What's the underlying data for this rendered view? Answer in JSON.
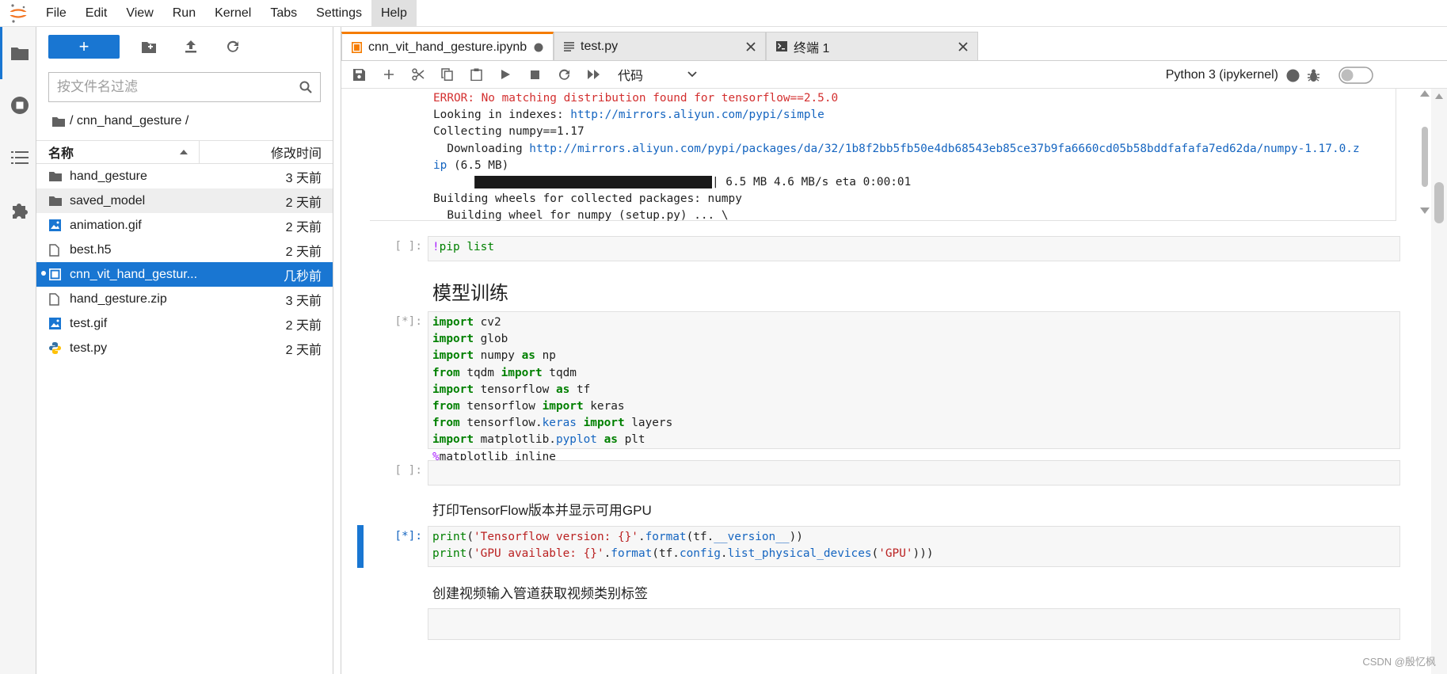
{
  "menubar": {
    "items": [
      "File",
      "Edit",
      "View",
      "Run",
      "Kernel",
      "Tabs",
      "Settings",
      "Help"
    ],
    "active_index": 7
  },
  "left_rail": {
    "icons": [
      "folder-icon",
      "running-icon",
      "toc-icon",
      "extension-icon"
    ]
  },
  "file_browser": {
    "new_label": "+",
    "filter_placeholder": "按文件名过滤",
    "breadcrumb": "/ cnn_hand_gesture /",
    "col_name": "名称",
    "col_modified": "修改时间",
    "files": [
      {
        "name": "hand_gesture",
        "modified": "3 天前",
        "icon": "folder-icon"
      },
      {
        "name": "saved_model",
        "modified": "2 天前",
        "icon": "folder-icon"
      },
      {
        "name": "animation.gif",
        "modified": "2 天前",
        "icon": "image-icon"
      },
      {
        "name": "best.h5",
        "modified": "2 天前",
        "icon": "file-icon"
      },
      {
        "name": "cnn_vit_hand_gestur...",
        "modified": "几秒前",
        "icon": "notebook-icon"
      },
      {
        "name": "hand_gesture.zip",
        "modified": "3 天前",
        "icon": "file-icon"
      },
      {
        "name": "test.gif",
        "modified": "2 天前",
        "icon": "image-icon"
      },
      {
        "name": "test.py",
        "modified": "2 天前",
        "icon": "python-icon"
      }
    ]
  },
  "tabs": [
    {
      "label": "cnn_vit_hand_gesture.ipynb",
      "icon": "notebook-icon",
      "active": true
    },
    {
      "label": "test.py",
      "icon": "text-file-icon",
      "active": false
    },
    {
      "label": "终端 1",
      "icon": "terminal-icon",
      "active": false
    }
  ],
  "notebook_toolbar": {
    "cell_type": "代码",
    "kernel_name": "Python 3 (ipykernel)"
  },
  "output": {
    "error_line": "ERROR: No matching distribution found for tensorflow==2.5.0",
    "looking_prefix": "Looking in indexes: ",
    "looking_url": "http://mirrors.aliyun.com/pypi/simple",
    "collecting": "Collecting numpy==1.17",
    "downloading_prefix": "  Downloading ",
    "downloading_url": "http://mirrors.aliyun.com/pypi/packages/da/32/1b8f2bb5fb50e4db68543eb85ce37b9fa6660cd05b58bddfafafa7ed62da/numpy-1.17.0.z",
    "downloading_url2": "ip",
    "downloading_size": " (6.5 MB)",
    "progress_stats": "| 6.5 MB 4.6 MB/s eta 0:00:01",
    "building": "Building wheels for collected packages: numpy",
    "building_wheel": "  Building wheel for numpy (setup.py) ... \\"
  },
  "cells": {
    "pip_prompt": "[ ]:",
    "pip_code_bang": "!",
    "pip_code": "pip list",
    "md_heading": "模型训练",
    "imports_prompt": "[*]:",
    "empty_prompt": "[ ]:",
    "md_print": "打印TensorFlow版本并显示可用GPU",
    "print_prompt": "[*]:",
    "md_video": "创建视频输入管道获取视频类别标签"
  },
  "watermark": "CSDN @殷忆枫"
}
